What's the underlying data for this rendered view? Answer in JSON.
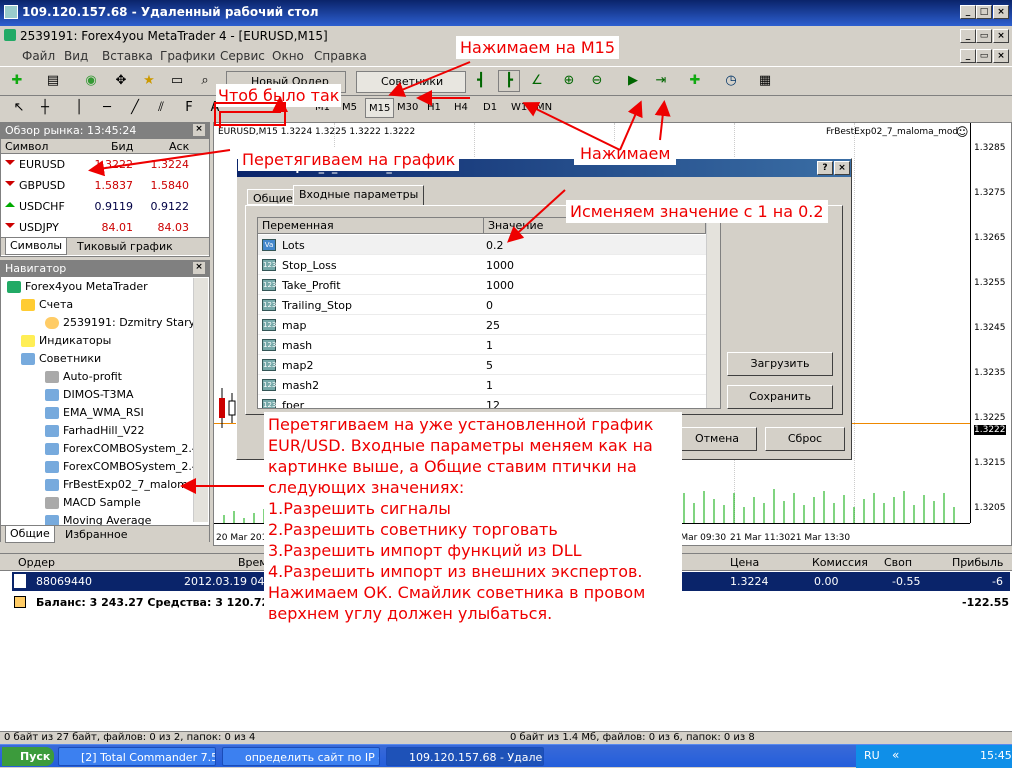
{
  "rdp": {
    "title": "109.120.157.68 - Удаленный рабочий стол"
  },
  "mt": {
    "title": "2539191: Forex4you MetaTrader 4 - [EURUSD,M15]"
  },
  "menu": [
    "Файл",
    "Вид",
    "Вставка",
    "Графики",
    "Сервис",
    "Окно",
    "Справка"
  ],
  "toolbar": {
    "new_order": "Новый Ордер",
    "advisors": "Советники"
  },
  "timeframes": [
    "M1",
    "M5",
    "M15",
    "M30",
    "H1",
    "H4",
    "D1",
    "W1",
    "MN"
  ],
  "market_watch": {
    "title": "Обзор рынка: 13:45:24",
    "col_symbol": "Символ",
    "col_bid": "Бид",
    "col_ask": "Аск",
    "rows": [
      {
        "symbol": "EURUSD",
        "bid": "1.3222",
        "ask": "1.3224"
      },
      {
        "symbol": "GBPUSD",
        "bid": "1.5837",
        "ask": "1.5840"
      },
      {
        "symbol": "USDCHF",
        "bid": "0.9119",
        "ask": "0.9122"
      },
      {
        "symbol": "USDJPY",
        "bid": "84.01",
        "ask": "84.03"
      }
    ],
    "tab_symbols": "Символы",
    "tab_tick": "Тиковый график"
  },
  "navigator": {
    "title": "Навигатор",
    "items": [
      "Forex4you MetaTrader",
      "Счета",
      "2539191: Dzmitry Starych",
      "Индикаторы",
      "Советники",
      "Auto-profit",
      "DIMOS-T3MA",
      "EMA_WMA_RSI",
      "FarhadHill_V22",
      "ForexCOMBOSystem_2.4",
      "ForexCOMBOSystem_2.4",
      "FrBestExp02_7_maloma",
      "MACD Sample",
      "Moving Average"
    ],
    "tab_common": "Общие",
    "tab_fav": "Избранное"
  },
  "chart": {
    "header": "EURUSD,M15  1.3224 1.3225 1.3222 1.3222",
    "ea_label": "FrBestExp02_7_maloma_mod",
    "prices": [
      "1.3285",
      "1.3275",
      "1.3265",
      "1.3255",
      "1.3245",
      "1.3235",
      "1.3225",
      "1.3222",
      "1.3215",
      "1.3205"
    ],
    "times": [
      "20 Mar 2012",
      "21 Mar 09:30",
      "21 Mar 11:30",
      "21 Mar 13:30"
    ]
  },
  "dialog": {
    "title": "FrBestExp02_7_maloma_mod",
    "tab_common": "Общие",
    "tab_inputs": "Входные параметры",
    "col_var": "Переменная",
    "col_val": "Значение",
    "params": [
      {
        "name": "Lots",
        "value": "0.2"
      },
      {
        "name": "Stop_Loss",
        "value": "1000"
      },
      {
        "name": "Take_Profit",
        "value": "1000"
      },
      {
        "name": "Trailing_Stop",
        "value": "0"
      },
      {
        "name": "map",
        "value": "25"
      },
      {
        "name": "mash",
        "value": "1"
      },
      {
        "name": "map2",
        "value": "5"
      },
      {
        "name": "mash2",
        "value": "1"
      },
      {
        "name": "fper",
        "value": "12"
      }
    ],
    "load": "Загрузить",
    "save": "Сохранить",
    "cancel": "Отмена",
    "reset": "Сброс"
  },
  "terminal": {
    "headers": [
      "Ордер",
      "Время",
      "Цена",
      "Комиссия",
      "Своп",
      "Прибыль"
    ],
    "row": {
      "order": "88069440",
      "time": "2012.03.19 04:1",
      "price": "1.3224",
      "commission": "0.00",
      "swap": "-0.55",
      "profit": "-6"
    },
    "balance": "Баланс: 3 243.27  Средства: 3 120.72  За",
    "balance_profit": "-122.55"
  },
  "status": {
    "left": "0 байт из 27 байт, файлов: 0 из 2, папок: 0 из 4",
    "right": "0 байт из 1.4 Мб, файлов: 0 из 6, папок: 0 из 8"
  },
  "taskbar": {
    "start": "Пуск",
    "items": [
      "[2] Total Commander 7.55...",
      "определить сайт по IP - ...",
      "109.120.157.68 - Удален..."
    ],
    "lang": "RU",
    "clock": "15:45"
  },
  "notes": {
    "m15": "Нажимаем на M15",
    "chtob": "Чтоб было так",
    "drag": "Перетягиваем на график",
    "press": "Нажимаем",
    "change": "Исменяем значение с 1 на 0.2",
    "main": [
      "Перетягиваем на уже установленной график",
      "EUR/USD. Входные параметры меняем как на",
      "картинке выше, а Общие ставим птички на",
      "следующих значениях:",
      "1.Разрешить сигналы",
      "2.Разрешить советнику торговать",
      "3.Разрешить импорт функций из DLL",
      "4.Разрешить импорт из внешних экспертов.",
      "Нажимаем ОК. Смайлик советника в провом",
      "верхнем углу должен улыбаться."
    ]
  }
}
